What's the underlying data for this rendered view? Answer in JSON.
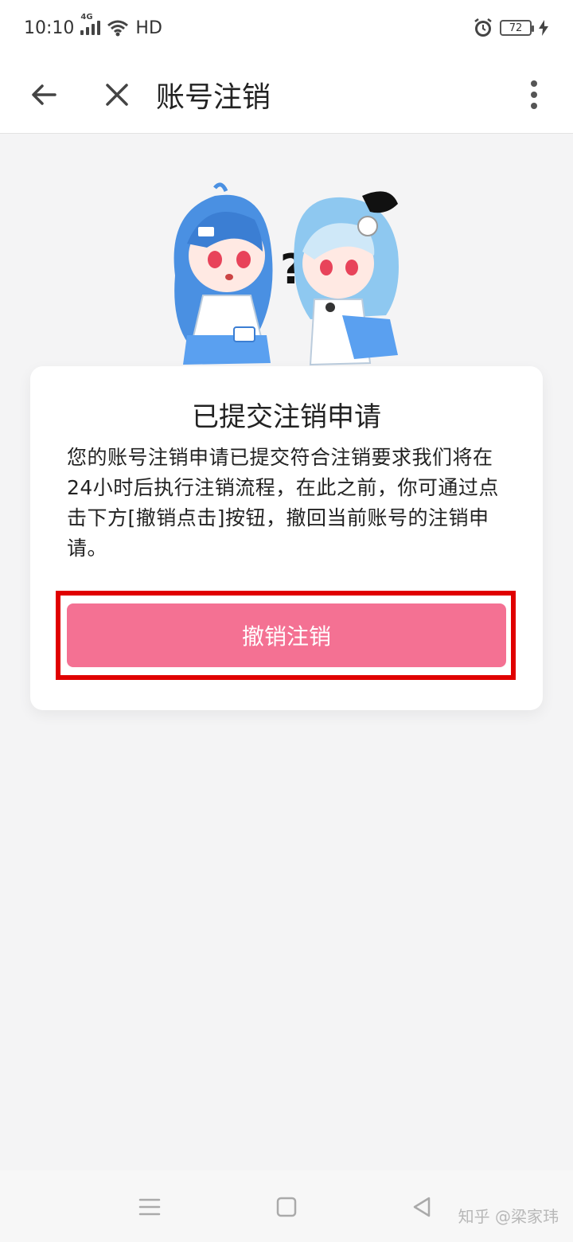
{
  "status_bar": {
    "time": "10:10",
    "network": "4G",
    "hd_label": "HD",
    "battery_level": "72"
  },
  "app_bar": {
    "title": "账号注销",
    "back_icon": "arrow-left-icon",
    "close_icon": "close-icon",
    "more_icon": "more-vertical-icon"
  },
  "card": {
    "title": "已提交注销申请",
    "body": "您的账号注销申请已提交符合注销要求我们将在24小时后执行注销流程，在此之前，你可通过点击下方[撤销点击]按钮，撤回当前账号的注销申请。",
    "button_label": "撤销注销"
  },
  "colors": {
    "accent": "#f47193",
    "highlight": "#e00000",
    "character_blue": "#4a90e2"
  },
  "nav_bar": {
    "menu_icon": "menu-icon",
    "home_icon": "square-home-icon",
    "back_icon": "triangle-back-icon"
  },
  "watermark": "知乎 @梁家玮"
}
